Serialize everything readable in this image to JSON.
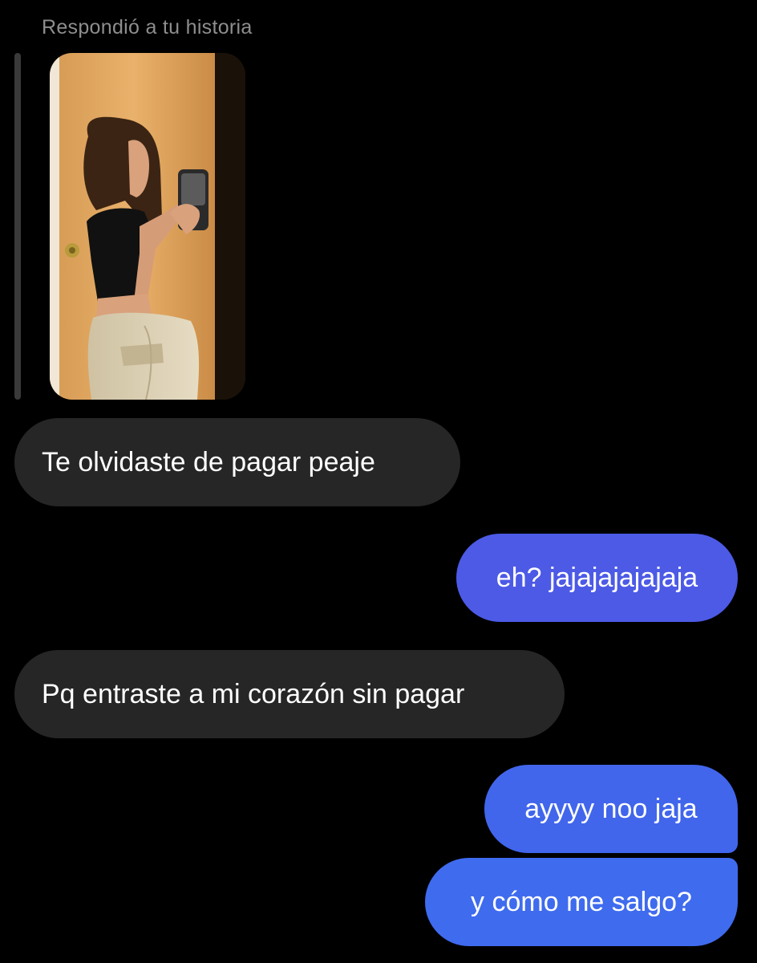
{
  "story_reply": {
    "label": "Respondió a tu historia",
    "thumbnail": "story photo: mirror selfie by a wooden door"
  },
  "messages": [
    {
      "side": "incoming",
      "text": "Te olvidaste de pagar peaje"
    },
    {
      "side": "outgoing",
      "text": "eh? jajajajajajaja"
    },
    {
      "side": "incoming",
      "text": "Pq entraste a mi corazón sin pagar"
    },
    {
      "side": "outgoing",
      "text": "ayyyy noo jaja"
    },
    {
      "side": "outgoing",
      "text": "y cómo me salgo?"
    }
  ],
  "colors": {
    "background": "#000000",
    "incoming_bubble": "#262626",
    "outgoing_bubble_top": "#4c5ae6",
    "outgoing_bubble_bottom": "#3f6bee",
    "label_text": "#8e8e8e"
  }
}
